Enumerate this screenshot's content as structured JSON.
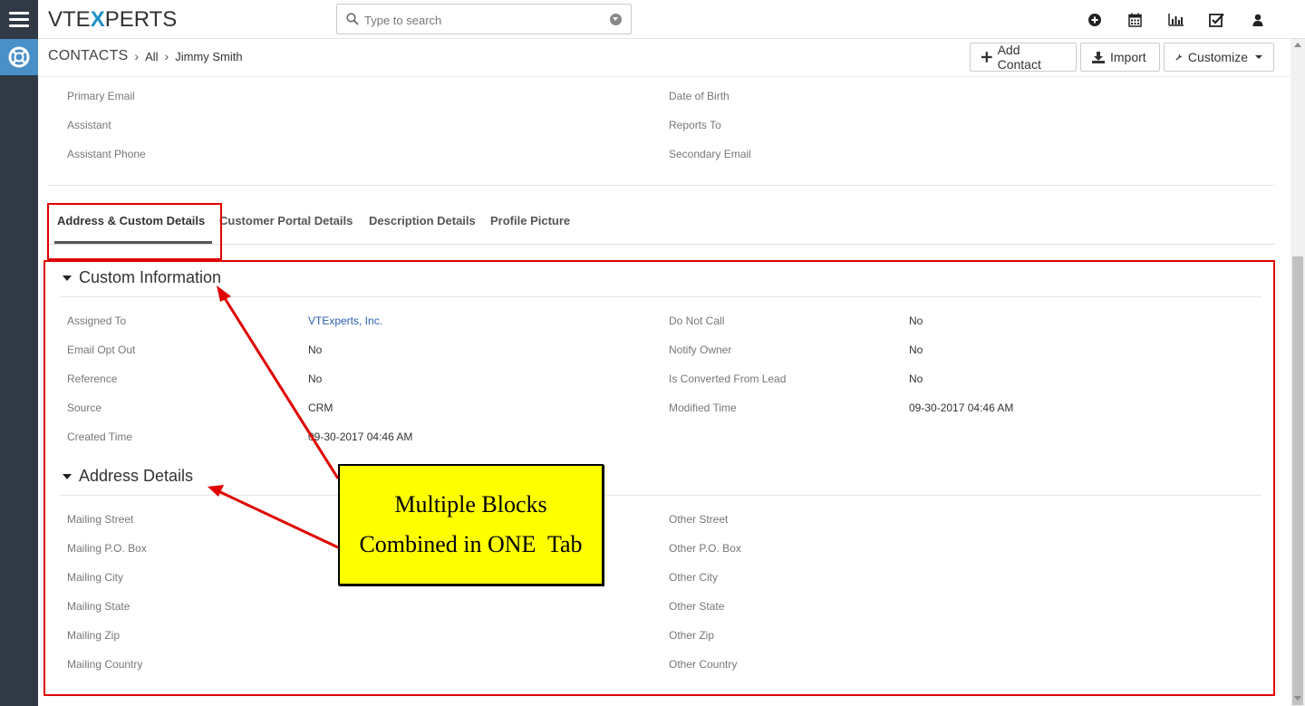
{
  "app": {
    "logo_text_1": "VTE",
    "logo_text_x": "X",
    "logo_text_2": "PERTS"
  },
  "search": {
    "placeholder": "Type to search"
  },
  "top_icons": [
    "add-icon",
    "calendar-icon",
    "reports-icon",
    "tasks-icon",
    "user-icon"
  ],
  "breadcrumb": {
    "module": "CONTACTS",
    "filter": "All",
    "record": "Jimmy Smith"
  },
  "header_buttons": {
    "add_contact": "Add Contact",
    "import": "Import",
    "customize": "Customize"
  },
  "top_fields": {
    "left": [
      "Primary Email",
      "Assistant",
      "Assistant Phone"
    ],
    "right": [
      "Date of Birth",
      "Reports To",
      "Secondary Email"
    ]
  },
  "tabs": [
    "Address & Custom Details",
    "Customer Portal Details",
    "Description Details",
    "Profile Picture"
  ],
  "custom_info": {
    "title": "Custom Information",
    "rows": [
      {
        "l1": "Assigned To",
        "v1": "VTExperts, Inc.",
        "l2": "Do Not Call",
        "v2": "No"
      },
      {
        "l1": "Email Opt Out",
        "v1": "No",
        "l2": "Notify Owner",
        "v2": "No"
      },
      {
        "l1": "Reference",
        "v1": "No",
        "l2": "Is Converted From Lead",
        "v2": "No"
      },
      {
        "l1": "Source",
        "v1": "CRM",
        "l2": "Modified Time",
        "v2": "09-30-2017 04:46 AM"
      },
      {
        "l1": "Created Time",
        "v1": "09-30-2017 04:46 AM",
        "l2": "",
        "v2": ""
      }
    ]
  },
  "address_details": {
    "title": "Address Details",
    "left": [
      "Mailing Street",
      "Mailing P.O. Box",
      "Mailing City",
      "Mailing State",
      "Mailing Zip",
      "Mailing Country"
    ],
    "right": [
      "Other Street",
      "Other P.O. Box",
      "Other City",
      "Other State",
      "Other Zip",
      "Other Country"
    ]
  },
  "callout": {
    "line1": "Multiple Blocks",
    "line2": "Combined in ONE  Tab"
  },
  "colors": {
    "annotation_red": "#e00000",
    "callout_yellow": "#ffff00",
    "sidebar": "#2f3a45",
    "link": "#2a5db0"
  }
}
